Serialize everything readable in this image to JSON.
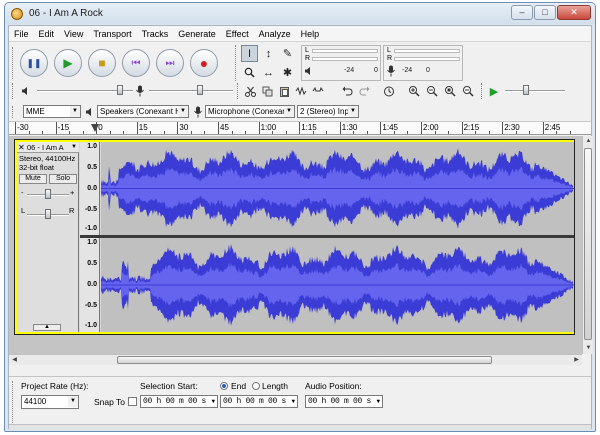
{
  "window": {
    "title": "06 - I Am A Rock",
    "minimize": "–",
    "maximize": "□",
    "close": "✕"
  },
  "menu": [
    "File",
    "Edit",
    "View",
    "Transport",
    "Tracks",
    "Generate",
    "Effect",
    "Analyze",
    "Help"
  ],
  "transport": {
    "pause_glyph": "❚❚",
    "play_glyph": "▶",
    "stop_glyph": "■",
    "skip_start_glyph": "⏮",
    "skip_end_glyph": "⏭",
    "record_glyph": "●"
  },
  "tools": {
    "selection": "I",
    "envelope": "↕",
    "draw": "✎",
    "zoom": "🔍",
    "timeshift": "↔",
    "multi": "✱"
  },
  "meters": {
    "left": "L",
    "right": "R",
    "scale_24": "-24",
    "scale_0": "0"
  },
  "devices": {
    "host": "MME",
    "output": "Speakers (Conexant Hig",
    "input": "Microphone (Conexant I",
    "channels": "2 (Stereo) Inp"
  },
  "ruler": {
    "labels": [
      "-30",
      "-15",
      "0",
      "15",
      "30",
      "45",
      "1:00",
      "1:15",
      "1:30",
      "1:45",
      "2:00",
      "2:15",
      "2:30",
      "2:45"
    ]
  },
  "track": {
    "close": "✕",
    "name": "06 - I Am A",
    "menu_arrow": "▼",
    "format": "Stereo, 44100Hz",
    "bits": "32-bit float",
    "mute": "Mute",
    "solo": "Solo",
    "gain_minus": "-",
    "gain_plus": "+",
    "pan_left": "L",
    "pan_right": "R",
    "collapse": "▲",
    "scale_top": [
      "1.0",
      "0.5",
      "0.0",
      "-0.5",
      "-1.0"
    ],
    "scale_bottom": [
      "1.0",
      "0.5",
      "0.0",
      "-0.5",
      "-1.0"
    ]
  },
  "waveform_color": "#3b3bd6",
  "waveform_core_color": "#6464ee",
  "selection_bar": {
    "project_rate_label": "Project Rate (Hz):",
    "project_rate": "44100",
    "snap_to": "Snap To",
    "selection_start_label": "Selection Start:",
    "end_label": "End",
    "length_label": "Length",
    "audio_position_label": "Audio Position:",
    "selection_start": "00 h 00 m 00 s",
    "selection_end": "00 h 00 m 00 s",
    "audio_position": "00 h 00 m 00 s"
  }
}
